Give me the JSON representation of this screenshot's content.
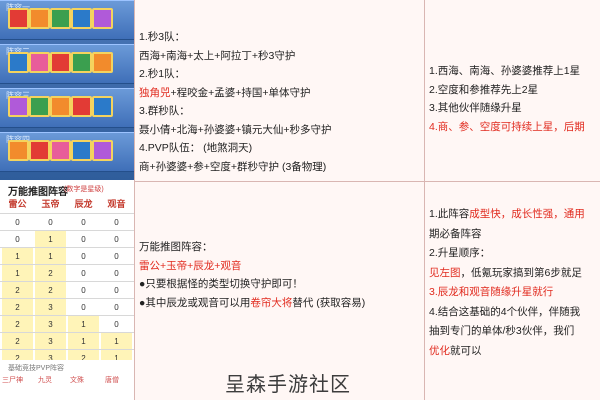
{
  "middle_top": {
    "line1": "1.秒3队：",
    "line2": "西海+南海+太上+阿拉丁+秒3守护",
    "line3": "2.秒1队：",
    "line4_red": "独角兕",
    "line4_rest": "+程咬金+孟婆+持国+单体守护",
    "line5": "3.群秒队：",
    "line6": "聂小倩+北海+孙婆婆+镇元大仙+秒多守护",
    "line7": "4.PVP队伍：   (地煞洞天)",
    "line8": "商+孙婆婆+参+空度+群秒守护   (3备物理)"
  },
  "right_top": {
    "line1": "1.西海、南海、孙婆婆推荐上1星",
    "line2": "2.空度和参推荐先上2星",
    "line3": "3.其他伙伴随缘升星",
    "line4": "4.商、参、空度可持续上星，后期"
  },
  "middle_bottom": {
    "line1": "万能推图阵容：",
    "line2": "雷公+玉帝+辰龙+观音",
    "line3": "●只要根据怪的类型切换守护即可！",
    "line4_pre": "●其中辰龙或观音可以用",
    "line4_red": "卷帘大将",
    "line4_post": "替代   (获取容易)"
  },
  "right_bottom": {
    "line1_pre": "1.此阵容",
    "line1_red": "成型快，成长性强，通用",
    "line2": "期必备阵容",
    "line3": "2.升星顺序：",
    "line4_red": "见左图",
    "line4_rest": "，低氪玩家搞到第6步就足",
    "line5_red": "3.辰龙和观音随缘升星就行",
    "line6": "4.结合这基础的4个伙伴，伴随我",
    "line7": "抽到专门的单体/秒3伙伴，我们",
    "line8_red": "优化",
    "line8_rest": "就可以"
  },
  "left_table": {
    "title": "万能推图阵容",
    "note": "(数字是星级)",
    "headers": [
      "雷公",
      "玉帝",
      "辰龙",
      "观音"
    ],
    "rows": [
      [
        "0",
        "0",
        "0",
        "0"
      ],
      [
        "0",
        "1",
        "0",
        "0"
      ],
      [
        "1",
        "1",
        "0",
        "0"
      ],
      [
        "1",
        "2",
        "0",
        "0"
      ],
      [
        "2",
        "2",
        "0",
        "0"
      ],
      [
        "2",
        "3",
        "0",
        "0"
      ],
      [
        "2",
        "3",
        "1",
        "0"
      ],
      [
        "2",
        "3",
        "1",
        "1"
      ],
      [
        "2",
        "3",
        "2",
        "1"
      ]
    ]
  },
  "left_small": {
    "title": "基础竞技PVP阵容",
    "names": [
      "三尸神",
      "九灵",
      "文殊",
      "唐僧"
    ]
  },
  "panel_labels": [
    "阵容一",
    "阵容二",
    "阵容三",
    "阵容四"
  ],
  "watermark": "呈森手游社区"
}
